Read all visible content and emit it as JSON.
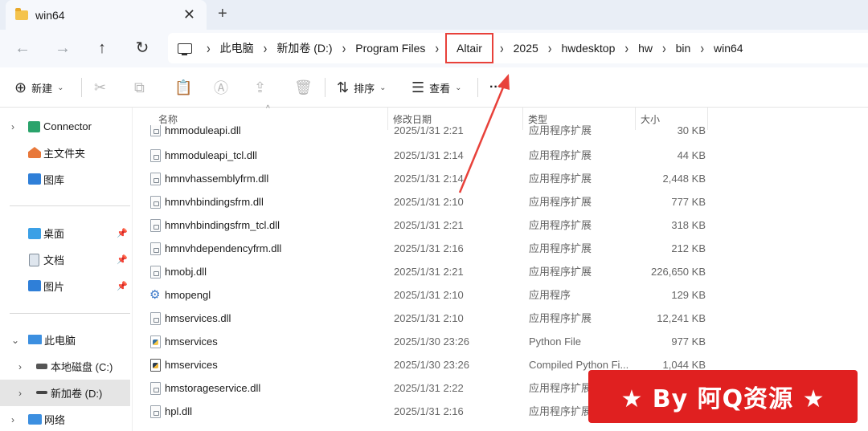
{
  "window": {
    "tab_title": "win64",
    "close_glyph": "✕",
    "newtab_glyph": "+"
  },
  "nav": {
    "back_glyph": "←",
    "forward_glyph": "→",
    "up_glyph": "↑",
    "refresh_glyph": "↻",
    "chevron": "›",
    "breadcrumbs": [
      "此电脑",
      "新加卷 (D:)",
      "Program Files",
      "Altair",
      "2025",
      "hwdesktop",
      "hw",
      "bin",
      "win64"
    ],
    "highlighted_crumb": "Altair"
  },
  "commandbar": {
    "new_label": "新建",
    "sort_label": "排序",
    "view_label": "查看",
    "more_glyph": "···",
    "caret": "⌄",
    "icons": [
      "new-icon",
      "cut-icon",
      "copy-icon",
      "paste-icon",
      "rename-icon",
      "share-icon",
      "delete-icon",
      "sort-icon",
      "view-icon",
      "more-icon"
    ]
  },
  "sidebar": {
    "items": [
      {
        "label": "Connector",
        "icon": "connector-icon",
        "chevron": "›"
      },
      {
        "label": "主文件夹",
        "icon": "home-icon"
      },
      {
        "label": "图库",
        "icon": "gallery-icon"
      },
      {
        "label": "桌面",
        "icon": "desktop-icon",
        "pinned": true
      },
      {
        "label": "文档",
        "icon": "documents-icon",
        "pinned": true
      },
      {
        "label": "图片",
        "icon": "pictures-icon",
        "pinned": true
      },
      {
        "label": "此电脑",
        "icon": "pc-icon",
        "chevron": "⌄"
      },
      {
        "label": "本地磁盘 (C:)",
        "icon": "drive-icon",
        "chevron": "›"
      },
      {
        "label": "新加卷 (D:)",
        "icon": "drive-icon",
        "chevron": "›",
        "selected": true
      },
      {
        "label": "网络",
        "icon": "network-icon",
        "chevron": "›"
      }
    ],
    "pin_glyph": "📌"
  },
  "filelist": {
    "columns": [
      "名称",
      "修改日期",
      "类型",
      "大小"
    ],
    "sort_glyph": "^",
    "rows": [
      {
        "name": "hmmoduleapi.dll",
        "date": "2025/1/31 2:21",
        "type": "应用程序扩展",
        "size": "30 KB",
        "icon": "dll-file-icon"
      },
      {
        "name": "hmmoduleapi_tcl.dll",
        "date": "2025/1/31 2:14",
        "type": "应用程序扩展",
        "size": "44 KB",
        "icon": "dll-file-icon"
      },
      {
        "name": "hmnvhassemblyfrm.dll",
        "date": "2025/1/31 2:14",
        "type": "应用程序扩展",
        "size": "2,448 KB",
        "icon": "dll-file-icon"
      },
      {
        "name": "hmnvhbindingsfrm.dll",
        "date": "2025/1/31 2:10",
        "type": "应用程序扩展",
        "size": "777 KB",
        "icon": "dll-file-icon"
      },
      {
        "name": "hmnvhbindingsfrm_tcl.dll",
        "date": "2025/1/31 2:21",
        "type": "应用程序扩展",
        "size": "318 KB",
        "icon": "dll-file-icon"
      },
      {
        "name": "hmnvhdependencyfrm.dll",
        "date": "2025/1/31 2:16",
        "type": "应用程序扩展",
        "size": "212 KB",
        "icon": "dll-file-icon"
      },
      {
        "name": "hmobj.dll",
        "date": "2025/1/31 2:21",
        "type": "应用程序扩展",
        "size": "226,650 KB",
        "icon": "dll-file-icon"
      },
      {
        "name": "hmopengl",
        "date": "2025/1/31 2:10",
        "type": "应用程序",
        "size": "129 KB",
        "icon": "exe-gear-icon"
      },
      {
        "name": "hmservices.dll",
        "date": "2025/1/31 2:10",
        "type": "应用程序扩展",
        "size": "12,241 KB",
        "icon": "dll-file-icon"
      },
      {
        "name": "hmservices",
        "date": "2025/1/30 23:26",
        "type": "Python File",
        "size": "977 KB",
        "icon": "python-file-icon"
      },
      {
        "name": "hmservices",
        "date": "2025/1/30 23:26",
        "type": "Compiled Python Fi...",
        "size": "1,044 KB",
        "icon": "compiled-python-icon"
      },
      {
        "name": "hmstorageservice.dll",
        "date": "2025/1/31 2:22",
        "type": "应用程序扩展",
        "size": "",
        "icon": "dll-file-icon"
      },
      {
        "name": "hpl.dll",
        "date": "2025/1/31 2:16",
        "type": "应用程序扩展",
        "size": "",
        "icon": "dll-file-icon"
      }
    ]
  },
  "annotation": {
    "arrow_color": "#e8413a"
  },
  "watermark": {
    "text": "★ By 阿Q资源 ★",
    "color": "#e02020"
  }
}
